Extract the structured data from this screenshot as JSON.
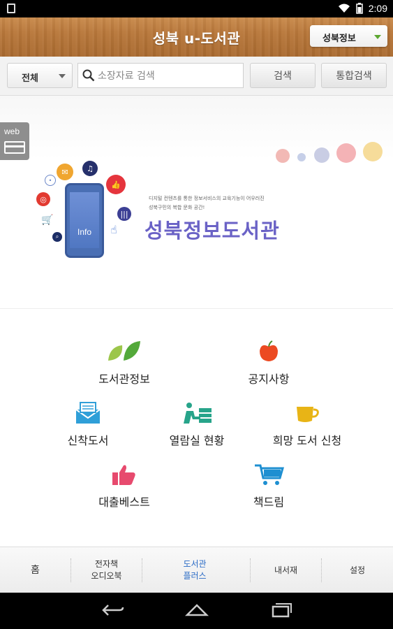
{
  "status_bar": {
    "time": "2:09",
    "icons": [
      "wifi-icon",
      "battery-icon"
    ]
  },
  "header": {
    "title": "성북 u-도서관",
    "dropdown_label": "성북정보"
  },
  "search": {
    "scope_label": "전체",
    "placeholder": "소장자료 검색",
    "value": "",
    "search_button": "검색",
    "unified_button": "통합검색"
  },
  "banner": {
    "web_tab_label": "web",
    "phone_label": "Info",
    "description_line1": "디지털 컨텐츠를 통한 정보서비스의 교육기능이 어우러진",
    "description_line2": "성북구민의 복합 문화 공간!",
    "title": "성북정보도서관"
  },
  "menu": {
    "items": [
      {
        "label": "도서관정보",
        "icon": "leaves-icon"
      },
      {
        "label": "공지사항",
        "icon": "apple-icon"
      },
      {
        "label": "신착도서",
        "icon": "mail-tray-icon"
      },
      {
        "label": "열람실 현황",
        "icon": "reading-room-icon"
      },
      {
        "label": "희망 도서 신청",
        "icon": "cup-icon"
      },
      {
        "label": "대출베스트",
        "icon": "thumbs-up-icon"
      },
      {
        "label": "책드림",
        "icon": "cart-icon"
      }
    ]
  },
  "bottom_nav": {
    "items": [
      {
        "label": "홈"
      },
      {
        "label": "전자책\n오디오북"
      },
      {
        "label": "도서관\n플러스"
      },
      {
        "label": "내서재"
      },
      {
        "label": "설정"
      }
    ],
    "active_index": 2
  },
  "colors": {
    "header_wood": "#b8773a",
    "banner_title": "#6a62c6",
    "active_nav": "#2a6bc6",
    "dropdown_arrow": "#5ca731"
  }
}
